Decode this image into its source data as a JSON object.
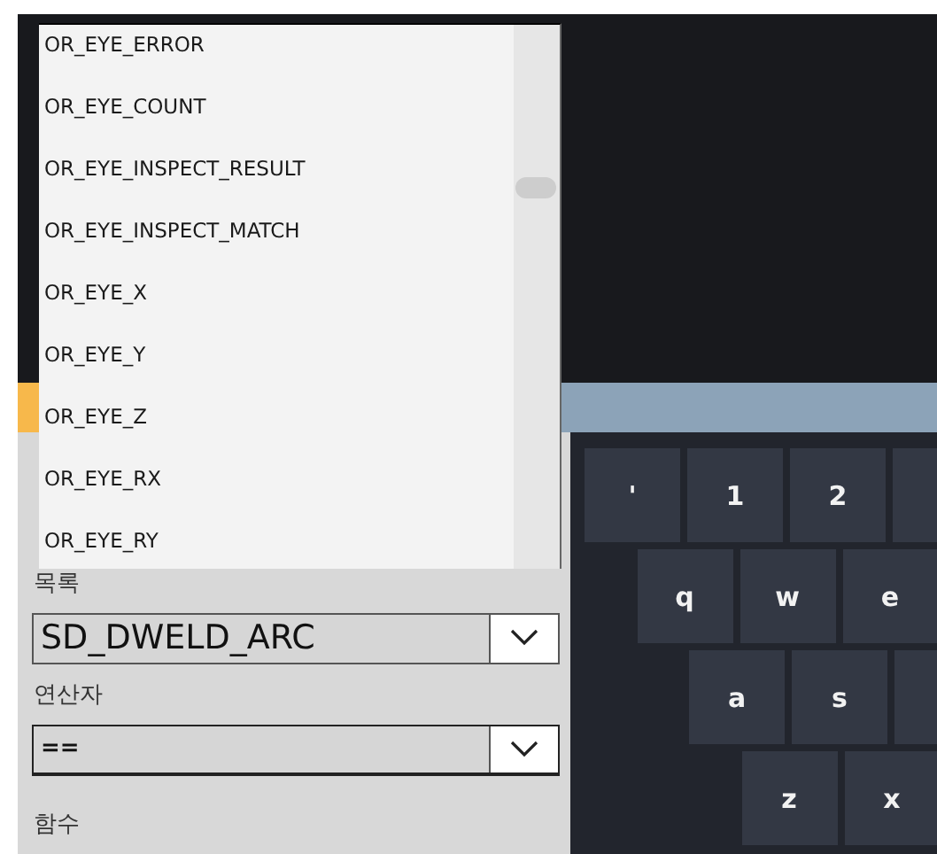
{
  "dropdown_list": {
    "items": [
      {
        "label": "OR_EYE_ERROR",
        "selected": false
      },
      {
        "label": "OR_EYE_COUNT",
        "selected": false
      },
      {
        "label": "OR_EYE_INSPECT_RESULT",
        "selected": false
      },
      {
        "label": "OR_EYE_INSPECT_MATCH",
        "selected": false
      },
      {
        "label": "OR_EYE_X",
        "selected": false
      },
      {
        "label": "OR_EYE_Y",
        "selected": false
      },
      {
        "label": "OR_EYE_Z",
        "selected": false
      },
      {
        "label": "OR_EYE_RX",
        "selected": false
      },
      {
        "label": "OR_EYE_RY",
        "selected": false
      }
    ]
  },
  "form": {
    "fields": [
      {
        "label": "목록",
        "value": "SD_DWELD_ARC",
        "kind": "large"
      },
      {
        "label": "연산자",
        "value": "==",
        "kind": "small"
      }
    ],
    "next_label": "함수"
  },
  "keyboard": {
    "rows": [
      [
        "'",
        "1",
        "2"
      ],
      [
        "q",
        "w",
        "e"
      ],
      [
        "a",
        "s"
      ],
      [
        "z",
        "x"
      ]
    ]
  }
}
